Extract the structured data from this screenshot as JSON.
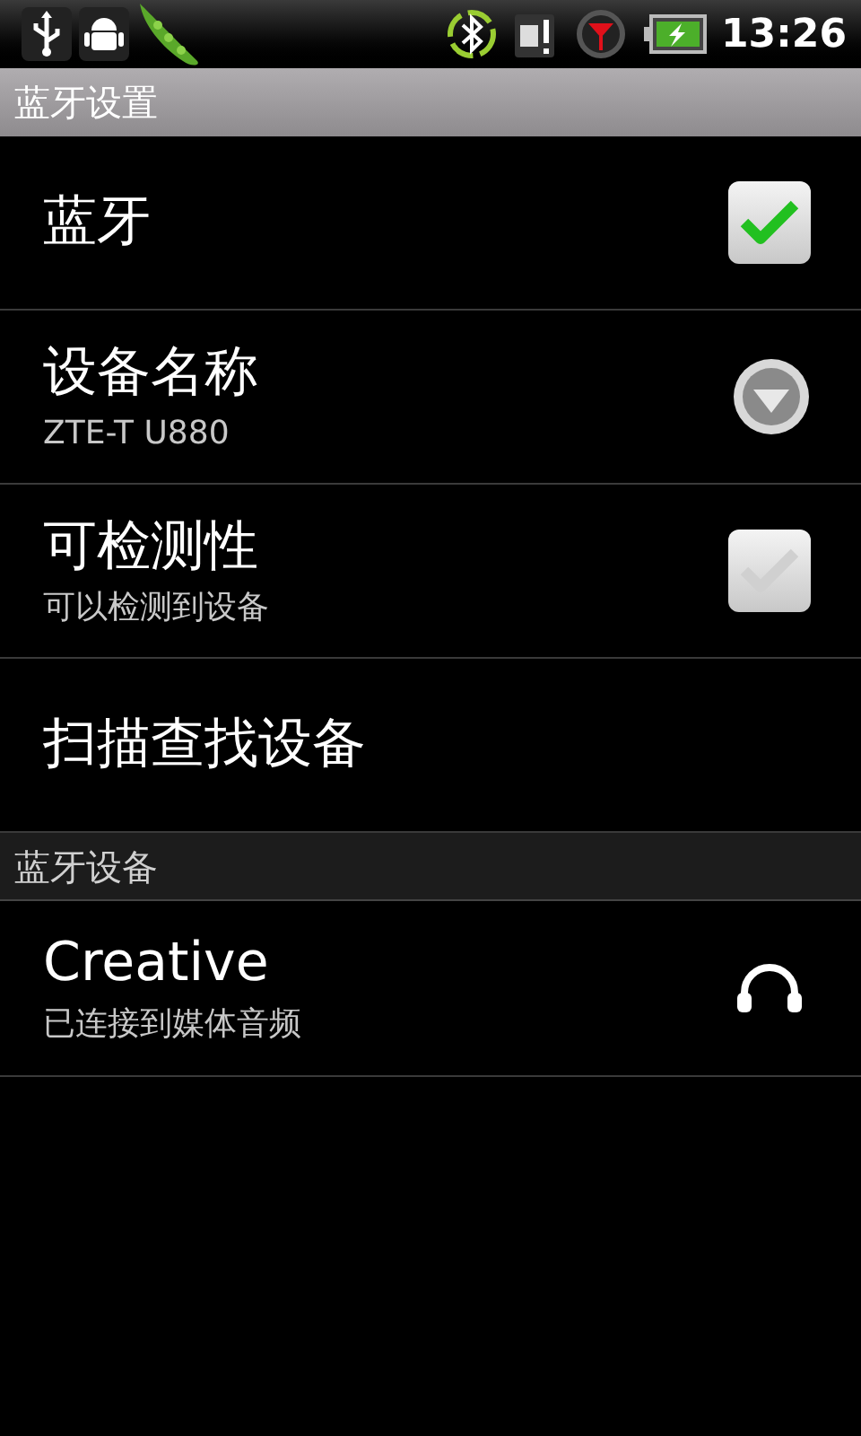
{
  "status_bar": {
    "time": "13:26"
  },
  "title": "蓝牙设置",
  "settings": [
    {
      "kind": "checkbox",
      "title": "蓝牙",
      "checked": true
    },
    {
      "kind": "dropdown",
      "title": "设备名称",
      "summary": "ZTE-T U880"
    },
    {
      "kind": "checkbox",
      "title": "可检测性",
      "summary": "可以检测到设备",
      "checked": false
    },
    {
      "kind": "action",
      "title": "扫描查找设备"
    }
  ],
  "devices_header": "蓝牙设备",
  "devices": [
    {
      "name": "Creative",
      "status": "已连接到媒体音频"
    }
  ]
}
